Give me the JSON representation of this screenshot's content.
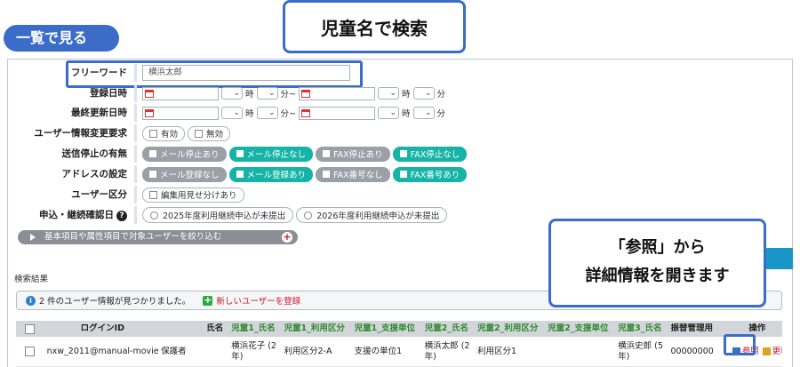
{
  "header": {
    "view_title": "一覧で見る"
  },
  "callouts": {
    "search_by_name": "児童名で検索",
    "reference_line1": "「参照」から",
    "reference_line2": "詳細情報を開きます"
  },
  "form": {
    "free_word": {
      "label": "フリーワード",
      "value": "横浜太郎"
    },
    "registered_at": {
      "label": "登録日時",
      "hour_unit": "時",
      "min_unit": "分",
      "range_sep": "分~",
      "end_unit": "分"
    },
    "updated_at": {
      "label": "最終更新日時",
      "hour_unit": "時",
      "min_unit": "分",
      "range_sep": "分~",
      "end_unit": "分"
    },
    "change_request": {
      "label": "ユーザー情報変更要求",
      "options": [
        "有効",
        "無効"
      ]
    },
    "delivery_stop": {
      "label": "送信停止の有無",
      "options": [
        "メール停止あり",
        "メール停止なし",
        "FAX停止あり",
        "FAX停止なし"
      ]
    },
    "address_setting": {
      "label": "アドレスの設定",
      "options": [
        "メール登録なし",
        "メール登録あり",
        "FAX番号なし",
        "FAX番号あり"
      ]
    },
    "user_category": {
      "label": "ユーザー区分",
      "options": [
        "編集用見せ分けあり"
      ]
    },
    "application_check": {
      "label": "申込・継続確認日",
      "help": "?",
      "options": [
        "2025年度利用継続申込が未提出",
        "2026年度利用継続申込が未提出"
      ]
    },
    "narrow_toggle": "基本項目や属性項目で対象ユーザーを絞り込む"
  },
  "results": {
    "title": "検索結果",
    "info_text": "2 件のユーザー情報が見つかりました。",
    "add_user": "新しいユーザーを登録",
    "columns": [
      "ログインID",
      "氏名",
      "児童1_氏名",
      "児童1_利用区分",
      "児童1_支援単位",
      "児童2_氏名",
      "児童2_利用区分",
      "児童2_支援単位",
      "児童3_氏名",
      "振替管理用",
      "操作"
    ],
    "rows": [
      {
        "login_id": "nxw_2011@manual-movie",
        "name": "保護者",
        "child1_name": "横浜花子 (2年)",
        "child1_category": "利用区分2-A",
        "child1_unit": "支援の単位1",
        "child2_name": "横浜太郎 (2年)",
        "child2_category": "利用区分1",
        "child2_unit": "",
        "child3_name": "横浜史郎 (5年)",
        "transfer": "00000000",
        "ref": "参照",
        "edit": "更新"
      }
    ]
  },
  "colors": {
    "accent": "#3a6cc8",
    "teal": "#16b4a7",
    "grey": "#9aa0a6",
    "red": "#c9182f"
  }
}
